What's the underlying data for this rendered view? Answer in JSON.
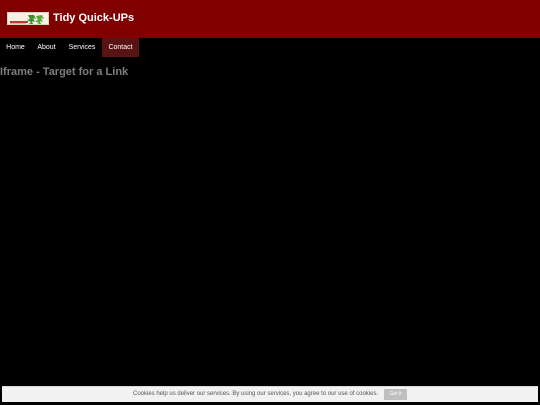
{
  "header": {
    "site_title": "Tidy Quick-UPs",
    "background_color": "#800000",
    "logo_icon": "company-logo"
  },
  "nav": {
    "items": [
      {
        "label": "Home",
        "active": false
      },
      {
        "label": "About",
        "active": false
      },
      {
        "label": "Services",
        "active": false
      },
      {
        "label": "Contact",
        "active": true
      }
    ],
    "active_color": "#5a1313"
  },
  "main": {
    "heading": "Iframe - Target for a Link"
  },
  "cookie_bar": {
    "message": "Cookies help us deliver our services. By using our services, you agree to our use of cookies.",
    "button_label": "Got it"
  }
}
